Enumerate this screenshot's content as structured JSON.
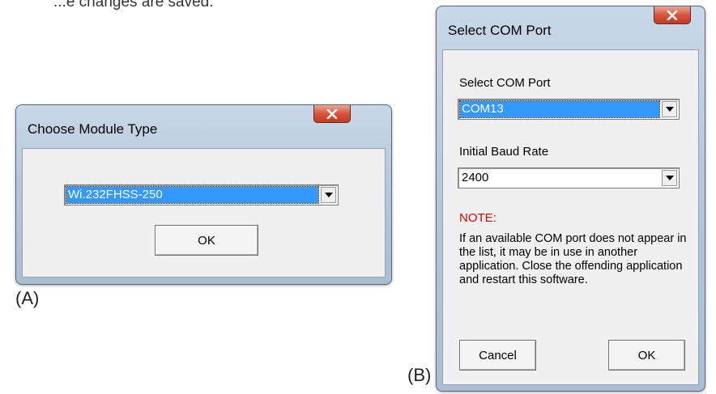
{
  "page": {
    "top_fragment": "...e changes are saved.",
    "label_a": "(A)",
    "label_b": "(B)"
  },
  "dialog_a": {
    "title": "Choose Module Type",
    "module_type_value": "Wi.232FHSS-250",
    "ok_label": "OK"
  },
  "dialog_b": {
    "title": "Select COM Port",
    "com_port_label": "Select COM Port",
    "com_port_value": "COM13",
    "baud_label": "Initial Baud Rate",
    "baud_value": "2400",
    "note_title": "NOTE:",
    "note_body": "If an available COM port does not appear in the list, it may be in use in another application.  Close the offending application and restart this software.",
    "cancel_label": "Cancel",
    "ok_label": "OK"
  },
  "colors": {
    "selection": "#3399ff",
    "note": "#e00000",
    "close_button": "#d8553c"
  }
}
